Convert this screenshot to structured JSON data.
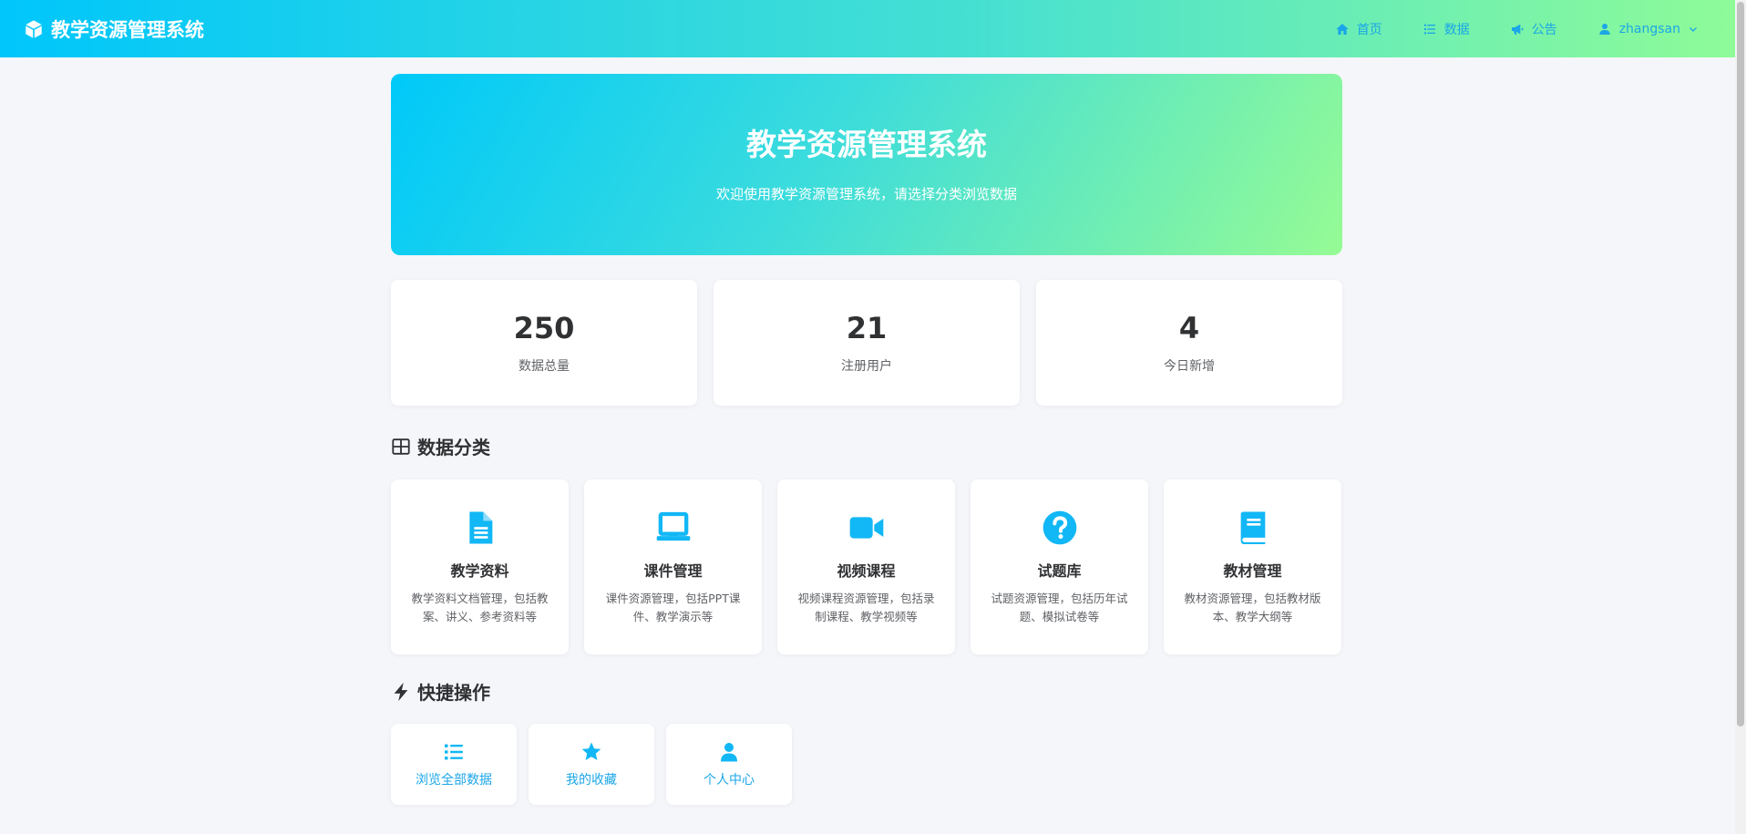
{
  "header": {
    "brand": "教学资源管理系统",
    "nav": [
      {
        "label": "首页",
        "icon": "home-icon"
      },
      {
        "label": "数据",
        "icon": "list-icon"
      },
      {
        "label": "公告",
        "icon": "megaphone-icon"
      }
    ],
    "user": {
      "name": "zhangsan",
      "icon": "user-icon"
    }
  },
  "hero": {
    "title": "教学资源管理系统",
    "subtitle": "欢迎使用教学资源管理系统，请选择分类浏览数据"
  },
  "stats": [
    {
      "value": "250",
      "label": "数据总量"
    },
    {
      "value": "21",
      "label": "注册用户"
    },
    {
      "value": "4",
      "label": "今日新增"
    }
  ],
  "categories_section": {
    "title": "数据分类",
    "icon": "table-icon"
  },
  "categories": [
    {
      "title": "教学资料",
      "desc": "教学资料文档管理，包括教案、讲义、参考资料等",
      "icon": "document-icon"
    },
    {
      "title": "课件管理",
      "desc": "课件资源管理，包括PPT课件、教学演示等",
      "icon": "laptop-icon"
    },
    {
      "title": "视频课程",
      "desc": "视频课程资源管理，包括录制课程、教学视频等",
      "icon": "video-icon"
    },
    {
      "title": "试题库",
      "desc": "试题资源管理，包括历年试题、模拟试卷等",
      "icon": "question-icon"
    },
    {
      "title": "教材管理",
      "desc": "教材资源管理，包括教材版本、教学大纲等",
      "icon": "book-icon"
    }
  ],
  "quick_section": {
    "title": "快捷操作",
    "icon": "bolt-icon"
  },
  "quick_actions": [
    {
      "label": "浏览全部数据",
      "icon": "list-icon"
    },
    {
      "label": "我的收藏",
      "icon": "star-icon"
    },
    {
      "label": "个人中心",
      "icon": "user-icon"
    }
  ],
  "colors": {
    "accent": "#1ba6e8",
    "icon": "#12b7f5",
    "gradient_start": "#00c6fb",
    "gradient_end": "#8efb98",
    "background": "#f4f6f9"
  }
}
